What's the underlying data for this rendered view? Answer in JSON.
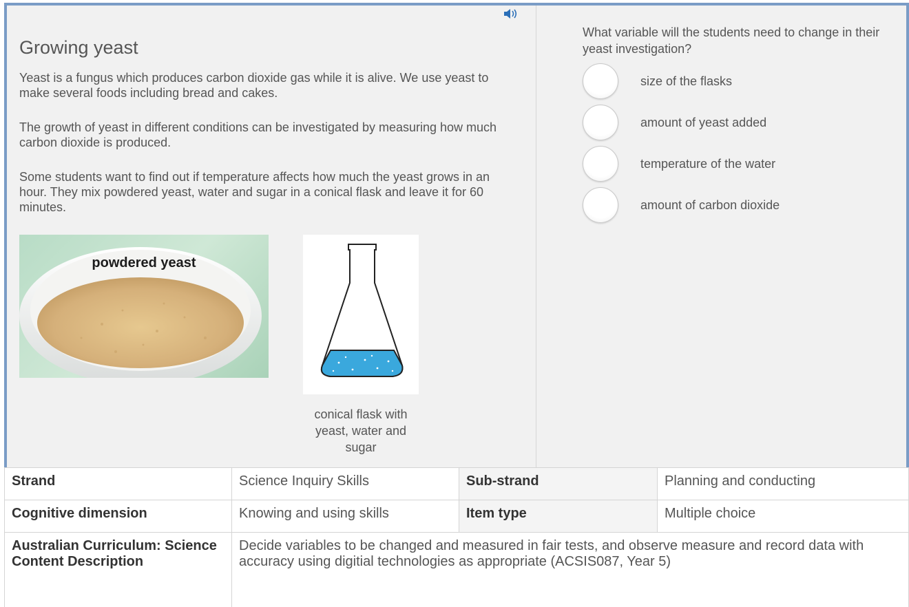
{
  "stimulus": {
    "title": "Growing yeast",
    "paragraphs": [
      "Yeast is a fungus which produces carbon dioxide gas while it is alive. We use yeast to make several foods including bread and cakes.",
      "The growth of yeast in different conditions can be investigated by measuring how much carbon dioxide is produced.",
      "Some students want to find out if temperature affects how much the yeast grows in an hour. They mix powdered yeast, water and sugar in a conical flask and leave it for 60 minutes."
    ],
    "yeast_image_label": "powdered yeast",
    "flask_caption": "conical flask with yeast, water and sugar",
    "audio_icon": "speaker-icon"
  },
  "question": {
    "text": "What variable will the students need to change in their yeast investigation?",
    "options": [
      "size of the flasks",
      "amount of yeast added",
      "temperature of the water",
      "amount of carbon dioxide"
    ],
    "next_icon": "play-arrow-icon"
  },
  "metadata": {
    "strand_label": "Strand",
    "strand_value": "Science Inquiry Skills",
    "substrand_label": "Sub-strand",
    "substrand_value": "Planning and conducting",
    "cognitive_label": "Cognitive dimension",
    "cognitive_value": "Knowing and using skills",
    "itemtype_label": "Item type",
    "itemtype_value": "Multiple choice",
    "curriculum_label": "Australian Curriculum: Science Content Description",
    "curriculum_value": "Decide variables to be changed and measured in fair tests, and observe measure and record data with accuracy using digitial technologies as appropriate (ACSIS087, Year 5)"
  },
  "colors": {
    "frame_border": "#7a9cc6",
    "panel_bg": "#f1f1f1",
    "arrow": "#2b8ad8",
    "liquid": "#3aa8dd"
  }
}
